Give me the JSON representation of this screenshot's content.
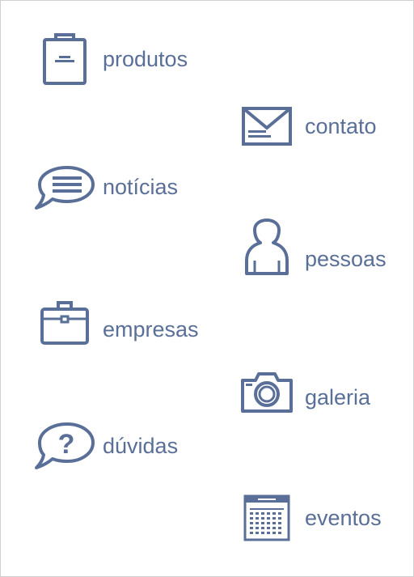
{
  "theme": {
    "icon_color": "#5a6f98",
    "text_color": "#5a6f98",
    "background": "#ffffff"
  },
  "menu": {
    "produtos": {
      "label": "produtos",
      "icon": "shopping-bag-icon"
    },
    "contato": {
      "label": "contato",
      "icon": "envelope-icon"
    },
    "noticias": {
      "label": "notícias",
      "icon": "speech-bubble-lines-icon"
    },
    "pessoas": {
      "label": "pessoas",
      "icon": "person-icon"
    },
    "empresas": {
      "label": "empresas",
      "icon": "briefcase-icon"
    },
    "galeria": {
      "label": "galeria",
      "icon": "camera-icon"
    },
    "duvidas": {
      "label": "dúvidas",
      "icon": "question-bubble-icon"
    },
    "eventos": {
      "label": "eventos",
      "icon": "calendar-icon"
    }
  }
}
